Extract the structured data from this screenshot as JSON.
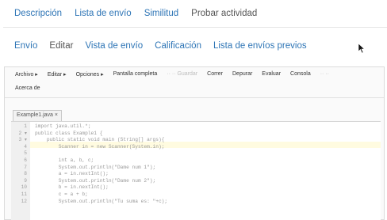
{
  "top_tabs": [
    {
      "label": "Descripción",
      "active": false
    },
    {
      "label": "Lista de envío",
      "active": false
    },
    {
      "label": "Similitud",
      "active": false
    },
    {
      "label": "Probar actividad",
      "active": true
    }
  ],
  "sub_tabs": [
    {
      "label": "Envío",
      "active": false
    },
    {
      "label": "Editar",
      "active": true
    },
    {
      "label": "Vista de envío",
      "active": false
    },
    {
      "label": "Calificación",
      "active": false
    },
    {
      "label": "Lista de envíos previos",
      "active": false
    }
  ],
  "editor_menu": {
    "items": [
      {
        "label": "Archivo ▸",
        "enabled": true
      },
      {
        "label": "Editar ▸",
        "enabled": true
      },
      {
        "label": "Opciones ▸",
        "enabled": true
      },
      {
        "label": "Pantalla completa",
        "enabled": true
      },
      {
        "label": "·· ·· Guardar",
        "enabled": false
      },
      {
        "label": "Correr",
        "enabled": true
      },
      {
        "label": "Depurar",
        "enabled": true
      },
      {
        "label": "Evaluar",
        "enabled": true
      },
      {
        "label": "Consola",
        "enabled": true
      },
      {
        "label": "·· ··",
        "enabled": false
      }
    ],
    "about": "Acerca de"
  },
  "file_tab": "Example1.java ×",
  "code_lines": [
    {
      "num": "1",
      "text": "import java.util.*;"
    },
    {
      "num": "2 ▾",
      "text": "public class Example1 {"
    },
    {
      "num": "3 ▾",
      "text": "    public static void main (String[] args){"
    },
    {
      "num": "4",
      "text": "        Scanner in = new Scanner(System.in);"
    },
    {
      "num": "5",
      "text": ""
    },
    {
      "num": "6",
      "text": "        int a, b, c;"
    },
    {
      "num": "7",
      "text": "        System.out.println(\"Dame num 1\");"
    },
    {
      "num": "8",
      "text": "        a = in.nextInt();"
    },
    {
      "num": "9",
      "text": "        System.out.println(\"Dame num 2\");"
    },
    {
      "num": "10",
      "text": "        b = in.nextInt();"
    },
    {
      "num": "11",
      "text": "        c = a + b;"
    },
    {
      "num": "12",
      "text": "        System.out.println(\"Tu suma es: \"+c);"
    }
  ],
  "colors": {
    "link": "#2e75b6",
    "active_tab": "#555555",
    "panel_bg": "#fafafa"
  },
  "icons": [
    "mouse-cursor-icon"
  ]
}
